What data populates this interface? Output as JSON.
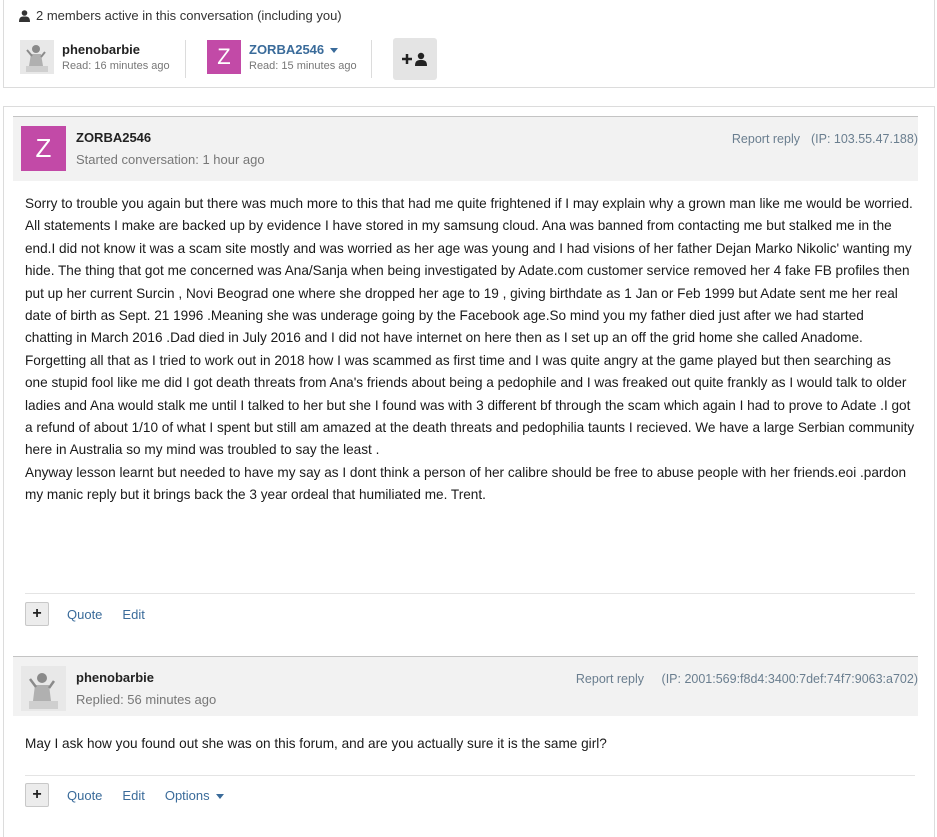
{
  "members": {
    "header": "2 members active in this conversation (including you)",
    "list": [
      {
        "name": "phenobarbie",
        "read": "Read: 16 minutes ago"
      },
      {
        "name": "ZORBA2546",
        "read": "Read: 15 minutes ago",
        "initial": "Z"
      }
    ]
  },
  "messages": [
    {
      "author": "ZORBA2546",
      "initial": "Z",
      "meta": "Started conversation: 1 hour ago",
      "report": "Report reply",
      "ip": "(IP: 103.55.47.188)",
      "paragraphs": [
        "Sorry to trouble you again but there was much more to this that had me quite frightened if I may explain why a grown man like me would be worried.",
        "All statements I make are backed up by evidence I have stored in my samsung cloud. Ana was banned from contacting me but stalked me in the end.I did not know it was a scam site mostly and was worried as her age was young and  I had visions of her father Dejan Marko Nikolic' wanting my hide. The thing that got me concerned was Ana/Sanja when being investigated by Adate.com customer service removed her 4 fake FB profiles then put up her current Surcin , Novi Beograd one where she dropped her age to 19 , giving birthdate as 1 Jan or Feb 1999 but Adate sent me her real date of birth as Sept. 21 1996 .Meaning she was underage going by the Facebook  age.So mind you my father died just after we had started chatting in March 2016 .Dad died in July 2016 and I did not have internet on here then as I set up an off the grid home she called Anadome.",
        "Forgetting all that as I tried to work out in 2018 how I was scammed as first time and I was quite angry at the game played but then searching as one stupid fool like me did I got death threats from Ana's friends about being a pedophile and I was freaked out quite frankly as I would talk to older ladies and Ana would stalk me until I talked to her but she I found was with 3 different bf through the scam which again I had to prove to Adate .I got a refund of about 1/10  of what I spent but still am amazed at the death threats and pedophilia taunts I recieved. We have a large Serbian community here in Australia so my mind was troubled to say the least .",
        "Anyway lesson learnt but needed to have my say as I dont think a person of her calibre should be free to abuse people with her friends.eoi .pardon my manic reply but it brings back the 3 year ordeal that humiliated me.  Trent."
      ],
      "actions": {
        "plus": "+",
        "quote": "Quote",
        "edit": "Edit"
      }
    },
    {
      "author": "phenobarbie",
      "meta": "Replied: 56 minutes ago",
      "report": "Report reply",
      "ip": "(IP: 2001:569:f8d4:3400:7def:74f7:9063:a702)",
      "paragraphs": [
        "May I ask how you found out she was on this forum, and are you actually sure it is the same girl?"
      ],
      "actions": {
        "plus": "+",
        "quote": "Quote",
        "edit": "Edit",
        "options": "Options"
      }
    }
  ],
  "colors": {
    "accent": "#3a6b9a",
    "avatar_z": "#c24aa7"
  }
}
